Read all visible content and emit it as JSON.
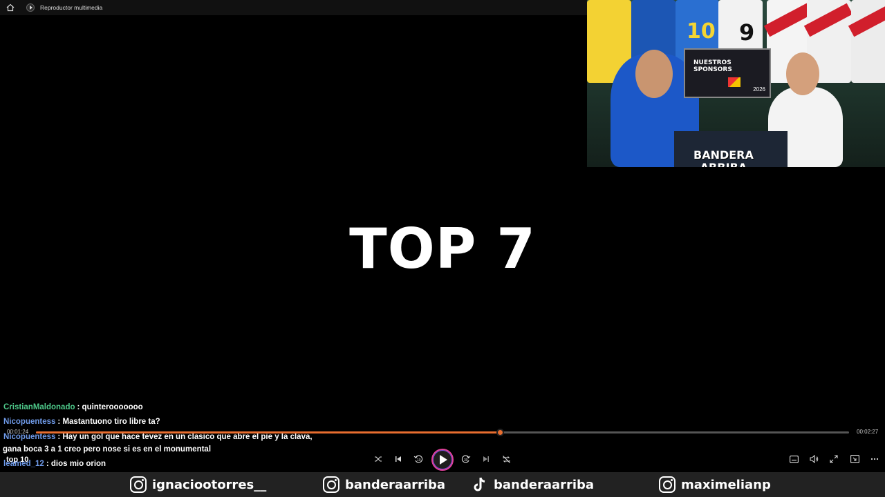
{
  "window": {
    "title": "Reproductor multimedia"
  },
  "video": {
    "headline": "TOP 7",
    "webcam": {
      "panel_text": "NUESTROS SPONSORS",
      "panel_year": "2026",
      "jersey_numbers": [
        "10",
        "9"
      ],
      "logo_line1": "BANDERA",
      "logo_line2": "ARRIBA"
    }
  },
  "chat": [
    {
      "user": "CristianMaldonado",
      "message": ": quinterooooooo",
      "color": "#4ec98a"
    },
    {
      "user": "Nicopuentess",
      "message": ": Mastantuono tiro libre ta?",
      "color": "#6f9ae8"
    },
    {
      "user": "Nicopuentess",
      "message": ": Hay un gol que hace tevez en un clasico que abre el pie y la clava,",
      "color": "#6f9ae8"
    },
    {
      "continuation": "gana boca 3 a 1 creo pero nose si es en el monumental"
    },
    {
      "user": "leamed_12",
      "message": ": dios mio orion",
      "color": "#6f9ae8"
    }
  ],
  "chat_overlap_text": "top 10",
  "player": {
    "current_time": "00:01:24",
    "total_time": "00:02:27",
    "progress_fraction": 0.571,
    "accent": "#e86d2f",
    "controls_left": [
      "shuffle-icon",
      "previous-icon",
      "rewind-10-icon",
      "play-icon",
      "forward-30-icon",
      "next-icon",
      "repeat-off-icon"
    ],
    "controls_right": [
      "captions-icon",
      "volume-icon",
      "fullscreen-icon",
      "mini-player-icon",
      "more-icon"
    ],
    "skip_back_label": "10",
    "skip_forward_label": "30"
  },
  "socials": [
    {
      "platform": "instagram",
      "handle": "ignaciootorres__"
    },
    {
      "platform": "instagram",
      "handle": "banderaarriba"
    },
    {
      "platform": "tiktok",
      "handle": "banderaarriba"
    },
    {
      "platform": "instagram",
      "handle": "maximelianp"
    }
  ]
}
